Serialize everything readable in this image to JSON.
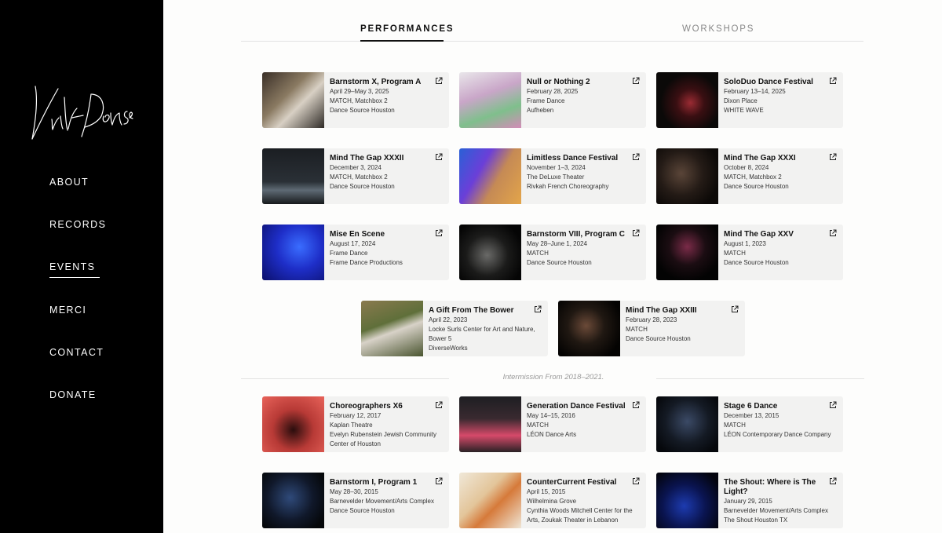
{
  "sidebar": {
    "logo_text": "Violet Donse",
    "nav": [
      {
        "label": "ABOUT"
      },
      {
        "label": "RECORDS"
      },
      {
        "label": "EVENTS"
      },
      {
        "label": "MERCI"
      },
      {
        "label": "CONTACT"
      },
      {
        "label": "DONATE"
      }
    ],
    "active_item": "EVENTS"
  },
  "tabs": {
    "performances": "PERFORMANCES",
    "workshops": "WORKSHOPS",
    "active": "PERFORMANCES"
  },
  "intermission": "Intermission From 2018–2021.",
  "cards": [
    {
      "title": "Barnstorm X, Program A",
      "date": "April 29–May 3, 2025",
      "venue": "MATCH, Matchbox 2",
      "org": "Dance Source Houston"
    },
    {
      "title": "Null or Nothing 2",
      "date": "February 28, 2025",
      "venue": "Frame Dance",
      "org": "Aufheben"
    },
    {
      "title": "SoloDuo Dance Festival",
      "date": "February 13–14, 2025",
      "venue": "Dixon Place",
      "org": "WHITE WAVE"
    },
    {
      "title": "Mind The Gap XXXII",
      "date": "December 3, 2024",
      "venue": "MATCH, Matchbox 2",
      "org": "Dance Source Houston"
    },
    {
      "title": "Limitless Dance Festival",
      "date": "November 1–3, 2024",
      "venue": "The DeLuxe Theater",
      "org": "Rivkah French Choreography"
    },
    {
      "title": "Mind The Gap XXXI",
      "date": "October 8, 2024",
      "venue": "MATCH, Matchbox 2",
      "org": "Dance Source Houston"
    },
    {
      "title": "Mise En Scene",
      "date": "August 17, 2024",
      "venue": "Frame Dance",
      "org": "Frame Dance Productions"
    },
    {
      "title": "Barnstorm VIII, Program C",
      "date": "May 28–June 1, 2024",
      "venue": "MATCH",
      "org": "Dance Source Houston"
    },
    {
      "title": "Mind The Gap XXV",
      "date": "August 1, 2023",
      "venue": "MATCH",
      "org": "Dance Source Houston"
    },
    {
      "title": "A Gift From The Bower",
      "date": "April 22, 2023",
      "venue": "Locke Surls Center for Art and Nature, Bower 5",
      "org": "DiverseWorks"
    },
    {
      "title": "Mind The Gap XXIII",
      "date": "February 28, 2023",
      "venue": "MATCH",
      "org": "Dance Source Houston"
    },
    {
      "title": "Choreographers X6",
      "date": "February 12, 2017",
      "venue": "Kaplan Theatre",
      "org": "Evelyn Rubenstein Jewish Community Center of Houston"
    },
    {
      "title": "Generation Dance Festival",
      "date": "May 14–15, 2016",
      "venue": "MATCH",
      "org": "LÉON Dance Arts"
    },
    {
      "title": "Stage 6 Dance",
      "date": "December 13, 2015",
      "venue": "MATCH",
      "org": "LÉON Contemporary Dance Company"
    },
    {
      "title": "Barnstorm I, Program 1",
      "date": "May 28–30, 2015",
      "venue": "Barnevelder Movement/Arts Complex",
      "org": "Dance Source Houston"
    },
    {
      "title": "CounterCurrent Festival",
      "date": "April 15, 2015",
      "venue": "Wilhelmina Grove",
      "org": "Cynthia Woods Mitchell Center for the Arts, Zoukak Theater in Lebanon"
    },
    {
      "title": "The Shout: Where is The Light?",
      "date": "January 29, 2015",
      "venue": "Barnevelder Movement/Arts Complex",
      "org": "The Shout Houston TX"
    }
  ],
  "icons": {
    "external_link": "external-link-icon"
  },
  "colors": {
    "sidebar_bg": "#000000",
    "card_bg": "#f2f2f1",
    "page_bg": "#fdfdfc"
  }
}
